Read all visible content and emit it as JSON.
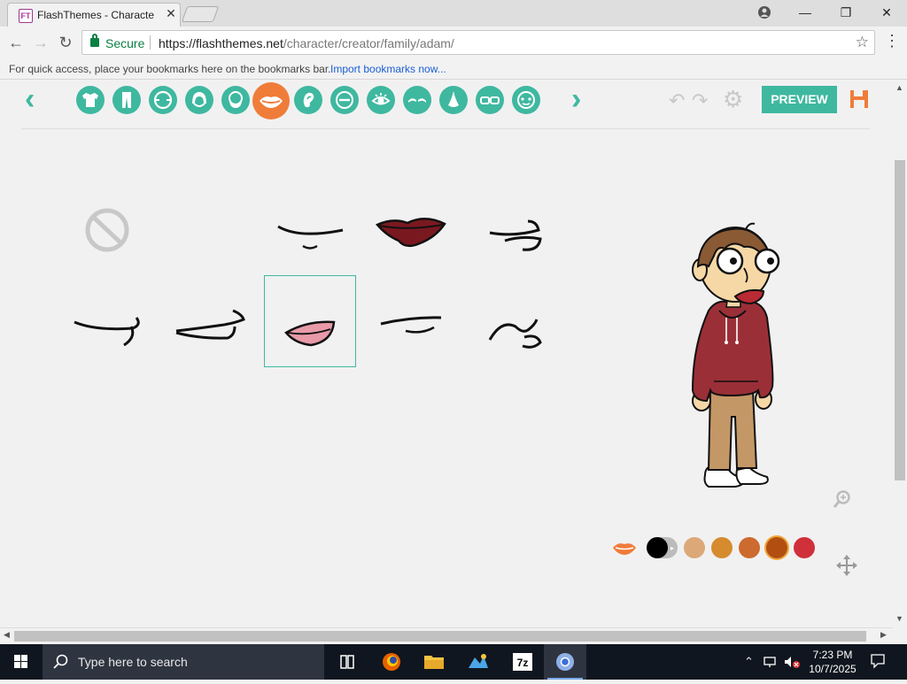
{
  "browser": {
    "tab_title": "FlashThemes - Character",
    "favicon_text": "FT",
    "secure_label": "Secure",
    "url_domain": "https://flashthemes.net",
    "url_path": "/character/creator/family/adam/",
    "bookmarks_hint": "For quick access, place your bookmarks here on the bookmarks bar.",
    "import_link": "Import bookmarks now..."
  },
  "editor": {
    "categories": [
      "shirt-icon",
      "pants-icon",
      "face-shape-icon",
      "hair-icon",
      "beard-icon",
      "mouth-icon",
      "ear-icon",
      "eye-shape-icon",
      "eye-icon",
      "eyebrow-icon",
      "nose-icon",
      "glasses-icon",
      "accessory-icon"
    ],
    "active_category": "mouth-icon",
    "preview_label": "PREVIEW",
    "selected_mouth": 7,
    "colors": [
      "#000000",
      "#dca878",
      "#d68b2e",
      "#cc6a30",
      "#b24f10",
      "#d0303a"
    ],
    "selected_color": "#b24f10",
    "accent": "#3fb8a0"
  },
  "taskbar": {
    "search_placeholder": "Type here to search",
    "time": "7:23 PM",
    "date": "10/7/2025"
  }
}
